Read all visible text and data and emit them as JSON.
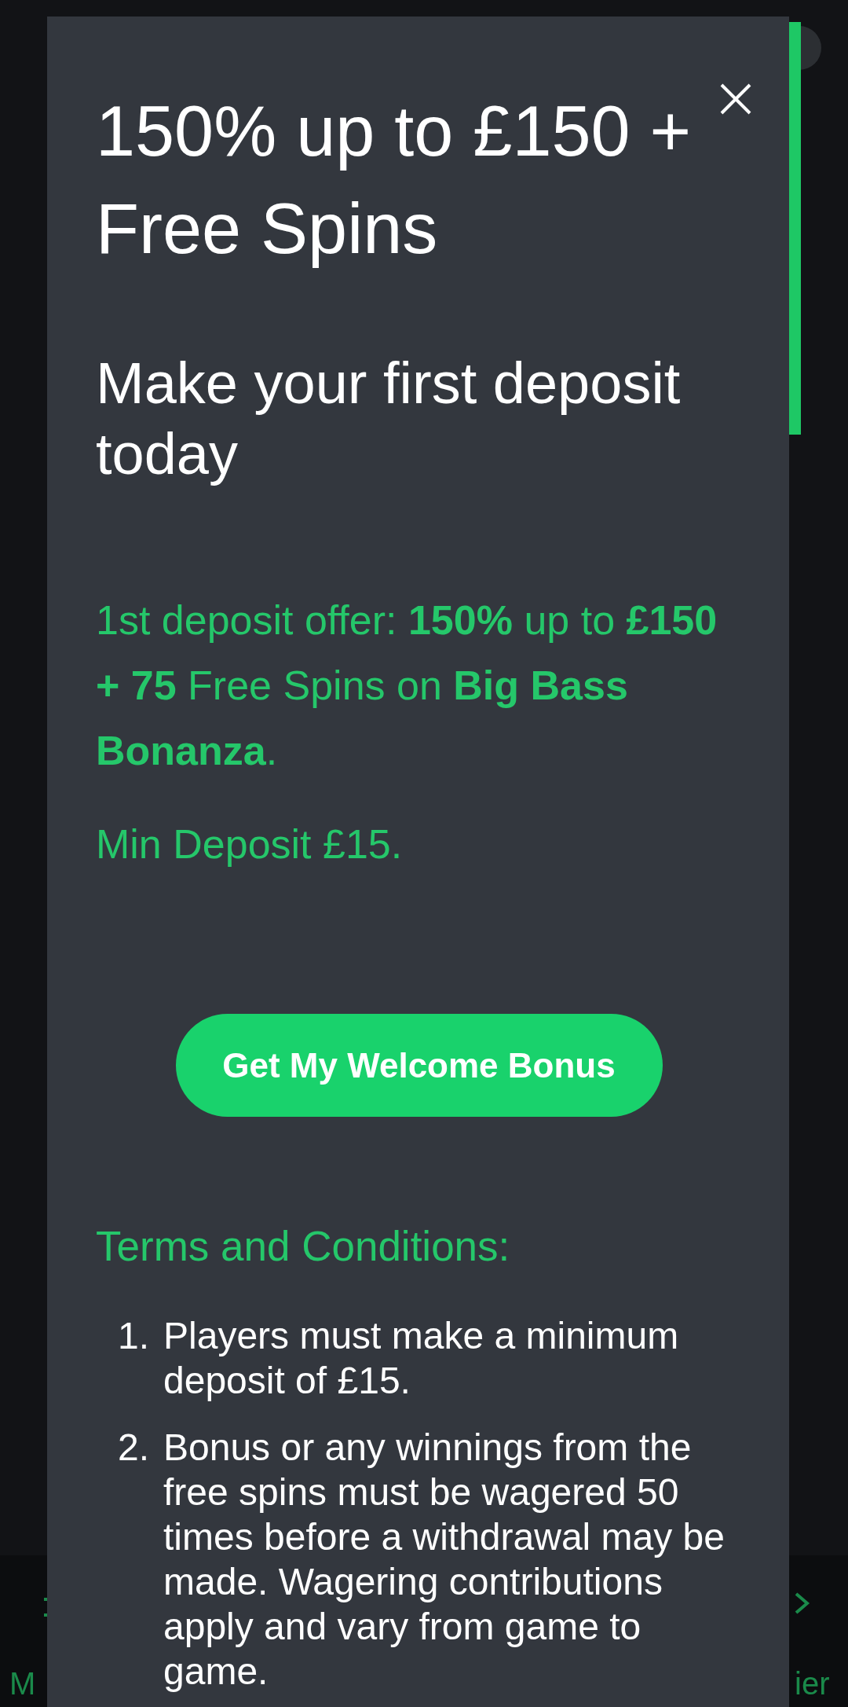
{
  "modal": {
    "title": "150% up to £150 + Free Spins",
    "subtitle": "Make your first deposit today",
    "offer": "1st deposit offer: **150%** up to **£150 + 75** Free Spins on **Big Bass Bonanza**.",
    "min_deposit": "Min Deposit £15.",
    "button": "Get My Welcome Bonus",
    "terms_heading": "Terms and Conditions:",
    "terms": [
      {
        "number": "1.",
        "text": "Players must make a minimum deposit of £15."
      },
      {
        "number": "2.",
        "text": "Bonus or any winnings from the free spins must be wagered 50 times before a withdrawal may be made. Wagering contributions apply and vary from game to game."
      }
    ]
  },
  "bottom_nav": [
    {
      "label": "M"
    },
    {
      "label": "ier"
    }
  ]
}
